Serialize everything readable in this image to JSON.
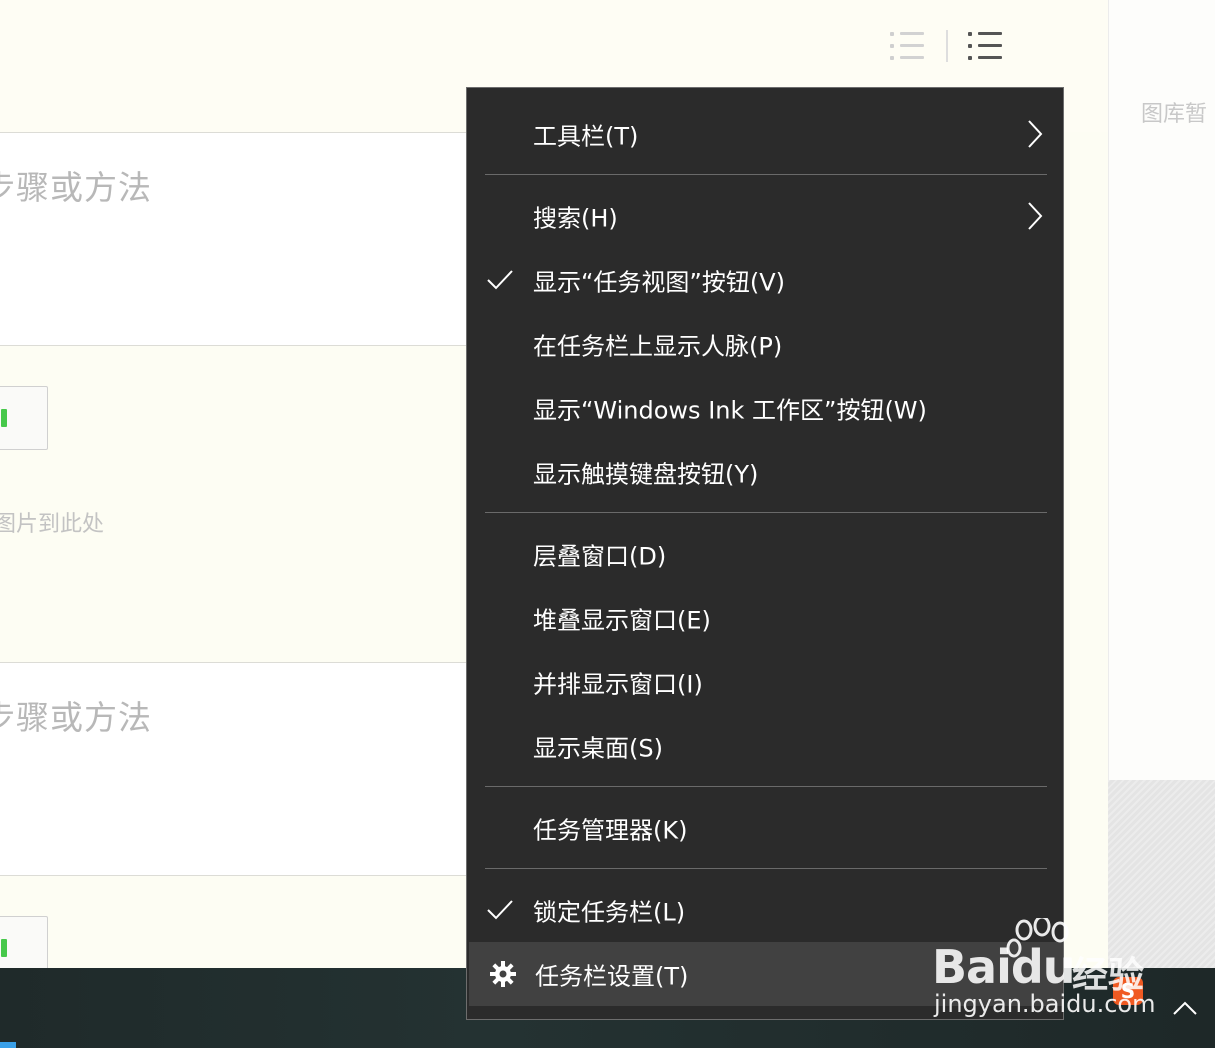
{
  "background": {
    "step_title": "步骤或方法",
    "drop_hint": "图片到此处",
    "gallery_label": "图库暂"
  },
  "menu": {
    "items": [
      {
        "label": "工具栏(T)",
        "submenu": true
      },
      {
        "label": "搜索(H)",
        "submenu": true
      },
      {
        "label": "显示“任务视图”按钮(V)",
        "checked": true
      },
      {
        "label": "在任务栏上显示人脉(P)"
      },
      {
        "label": "显示“Windows Ink 工作区”按钮(W)"
      },
      {
        "label": "显示触摸键盘按钮(Y)"
      },
      {
        "label": "层叠窗口(D)"
      },
      {
        "label": "堆叠显示窗口(E)"
      },
      {
        "label": "并排显示窗口(I)"
      },
      {
        "label": "显示桌面(S)"
      },
      {
        "label": "任务管理器(K)"
      },
      {
        "label": "锁定任务栏(L)",
        "checked": true
      },
      {
        "label": "任务栏设置(T)",
        "icon": "gear-icon",
        "highlighted": true
      }
    ]
  },
  "watermark": {
    "brand": "Bai",
    "brand_suffix": "du",
    "brand_cn": "经验",
    "url": "jingyan.baidu.com"
  },
  "colors": {
    "menu_bg": "#2b2b2b",
    "menu_highlight": "#414141",
    "taskbar": "#1f2a2a",
    "page_bg": "#fdfdf3"
  }
}
